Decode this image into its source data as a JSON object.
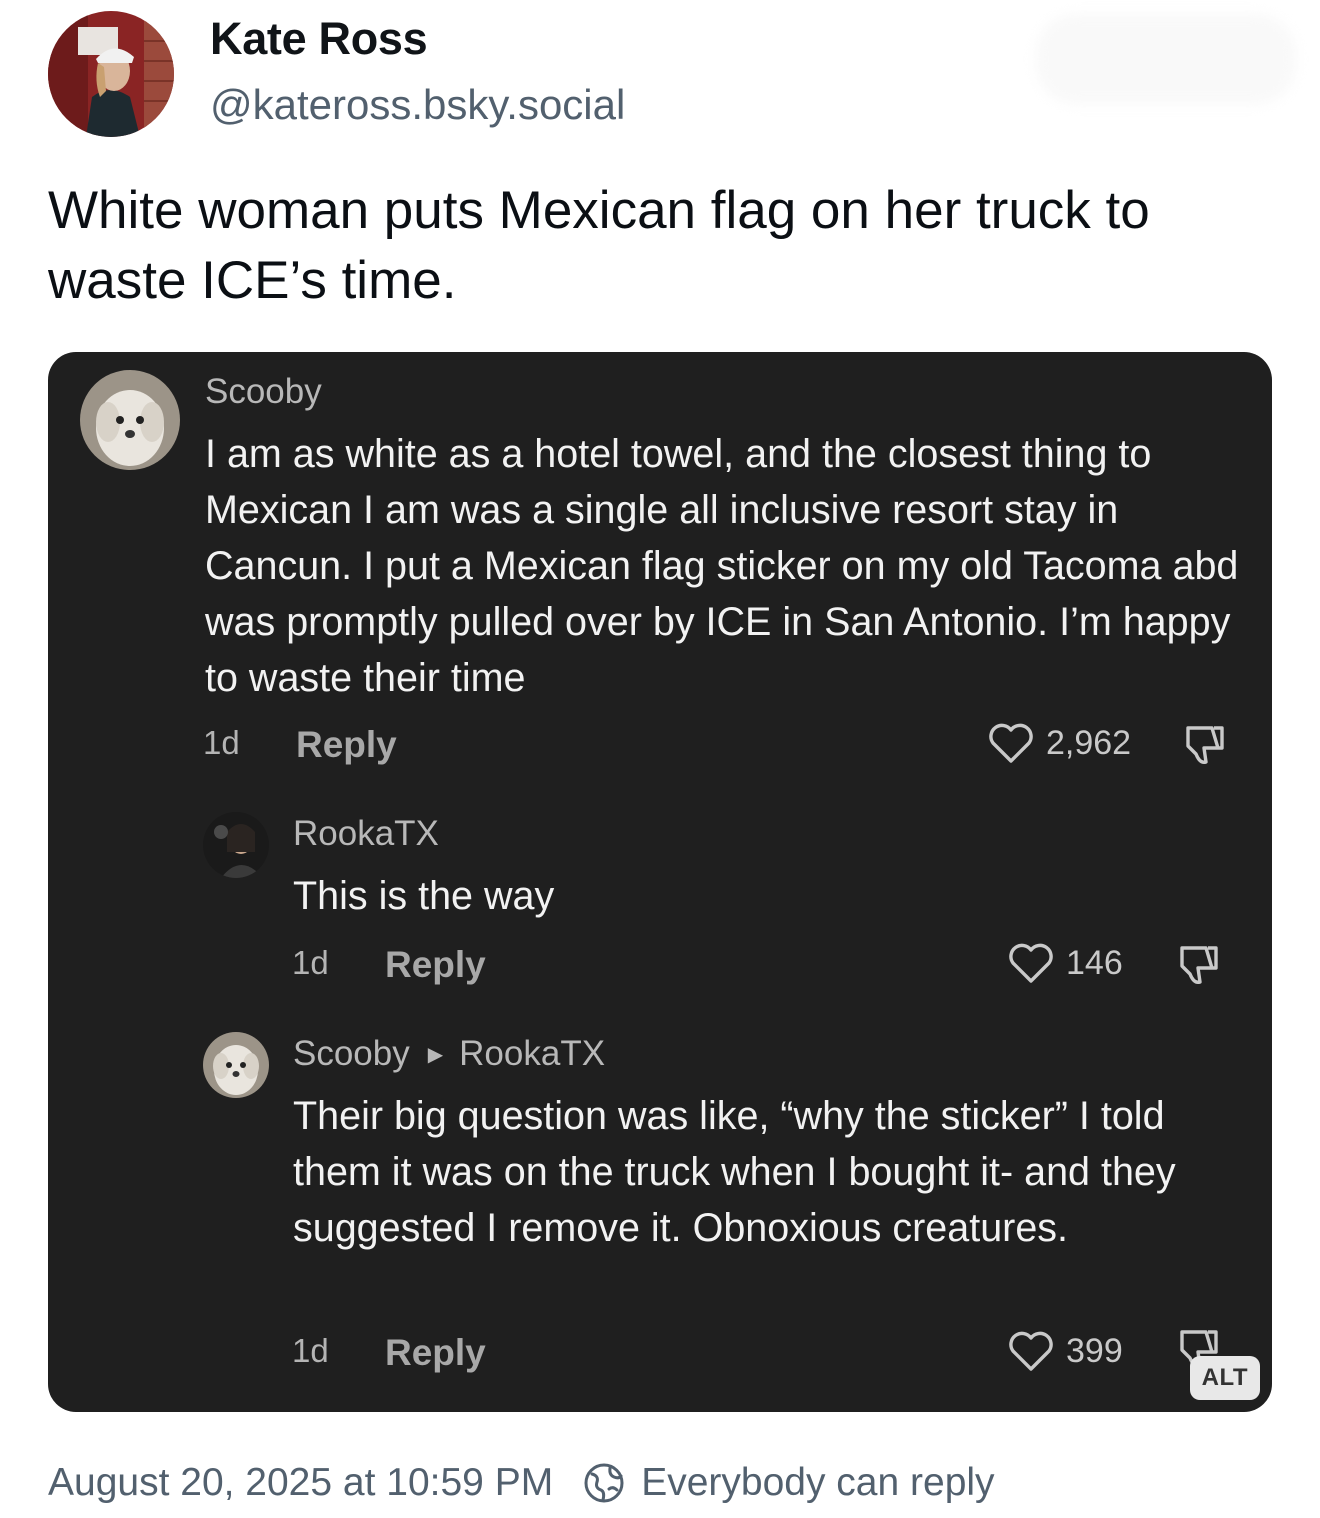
{
  "author": {
    "display_name": "Kate Ross",
    "handle": "@kateross.bsky.social",
    "avatar_icon": "profile-photo-avatar"
  },
  "post": {
    "text": "White woman puts Mexican flag on her truck to waste ICE’s time."
  },
  "embed": {
    "alt_badge": "ALT",
    "comments": [
      {
        "author": "Scooby",
        "text": "I am as white as a hotel towel, and the closest thing to Mexican I am was a single all inclusive resort stay in Cancun. I put a Mexican flag sticker on my old Tacoma abd was promptly pulled over by ICE in San Antonio. I’m happy to waste their time",
        "time": "1d",
        "reply_label": "Reply",
        "likes": "2,962"
      },
      {
        "author": "RookaTX",
        "text": "This is the way",
        "time": "1d",
        "reply_label": "Reply",
        "likes": "146"
      },
      {
        "author": "Scooby",
        "reply_to": "RookaTX",
        "text": "Their big question was like, “why the sticker” I told them it was on the truck when I bought it- and they suggested I remove it. Obnoxious creatures.",
        "time": "1d",
        "reply_label": "Reply",
        "likes": "399"
      }
    ]
  },
  "footer": {
    "timestamp": "August 20, 2025 at 10:59 PM",
    "reply_setting": "Everybody can reply",
    "reply_setting_icon": "globe-icon"
  },
  "colors": {
    "embed_background": "#1f1f1f",
    "muted_text": "#52606e"
  }
}
